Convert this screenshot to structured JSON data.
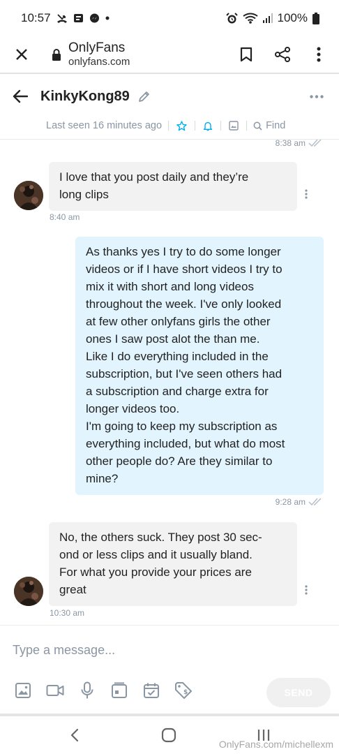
{
  "status_bar": {
    "time": "10:57",
    "battery": "100%"
  },
  "browser": {
    "title": "OnlyFans",
    "url": "onlyfans.com"
  },
  "chat": {
    "name": "KinkyKong89",
    "last_seen": "Last seen 16 minutes ago",
    "find_label": "Find"
  },
  "messages": [
    {
      "direction": "out",
      "time": "8:38 am",
      "text": ""
    },
    {
      "direction": "in",
      "time": "8:40 am",
      "text": "I love that you post daily and they’re long clips"
    },
    {
      "direction": "out",
      "time": "9:28 am",
      "lines": [
        "As thanks yes I try to do some longer",
        "videos or if I have short videos I try to",
        "mix it with short and long videos",
        "throughout the week. I've only looked",
        "at few other onlyfans girls the other",
        "ones I saw post alot the than me.",
        "Like I do everything included in the",
        "subscription, but I've seen others had",
        "a subscription and charge extra for",
        "longer videos too.",
        "I'm going to keep my subscription as",
        "everything included, but what do most",
        "other people do? Are they similar to",
        "mine?"
      ]
    },
    {
      "direction": "in",
      "time": "10:30 am",
      "lines": [
        "No, the others suck. They post 30 sec-",
        "ond or less clips and it usually bland.",
        "For what you provide your prices are",
        "great"
      ]
    }
  ],
  "msg_in_1": {
    "line1": "I love that you post daily and they’re",
    "line2": "long clips"
  },
  "composer": {
    "placeholder": "Type a message...",
    "send_label": "SEND"
  },
  "watermark": "OnlyFans.com/michellexm",
  "colors": {
    "accent": "#00aff0",
    "incoming_bubble": "#f2f2f2",
    "outgoing_bubble": "#e2f4fd",
    "muted_text": "#8a96a3"
  },
  "icons": {
    "browser": [
      "close-icon",
      "lock-icon",
      "bookmark-icon",
      "share-icon",
      "kebab-menu-icon"
    ],
    "chat_header": [
      "back-arrow-icon",
      "pencil-icon",
      "more-dots-icon",
      "star-icon",
      "bell-icon",
      "image-icon",
      "search-icon"
    ],
    "composer": [
      "image-icon",
      "video-icon",
      "microphone-icon",
      "vault-icon",
      "schedule-icon",
      "price-tag-icon"
    ],
    "nav": [
      "back-icon",
      "home-icon",
      "recents-icon"
    ]
  }
}
